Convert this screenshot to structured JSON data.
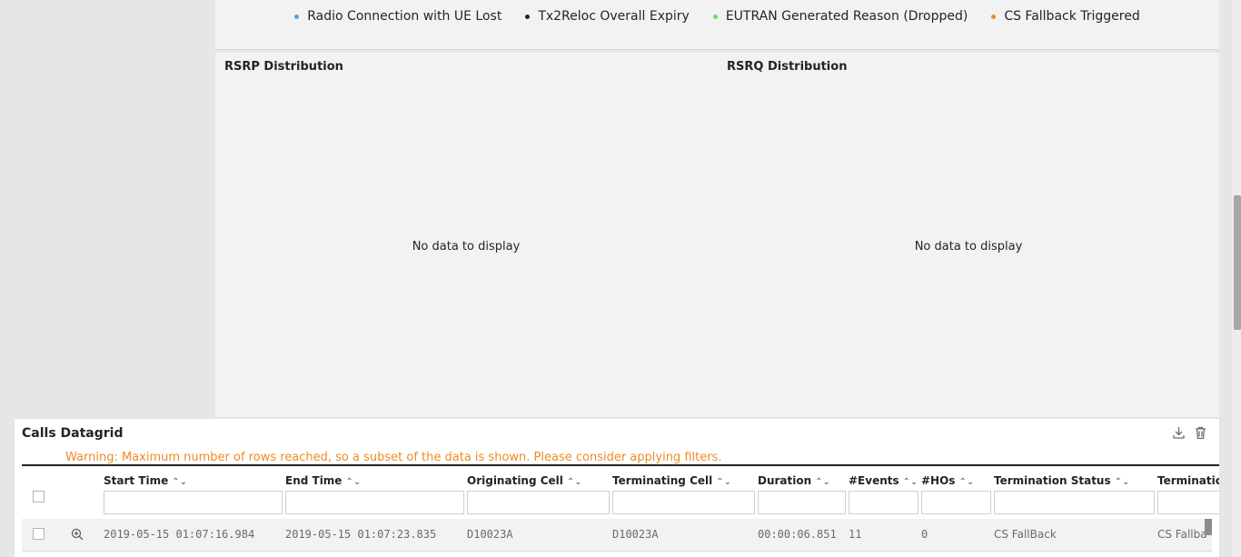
{
  "legend": [
    {
      "label": "Radio Connection with UE Lost",
      "color": "#4da6e6"
    },
    {
      "label": "Tx2Reloc Overall Expiry",
      "color": "#242424"
    },
    {
      "label": "EUTRAN Generated Reason (Dropped)",
      "color": "#5ee068"
    },
    {
      "label": "CS Fallback Triggered",
      "color": "#f08a24"
    }
  ],
  "charts": {
    "rsrp": {
      "title": "RSRP Distribution",
      "empty": "No data to display"
    },
    "rsrq": {
      "title": "RSRQ Distribution",
      "empty": "No data to display"
    }
  },
  "grid": {
    "title": "Calls Datagrid",
    "warning": "Warning: Maximum number of rows reached, so a subset of the data is shown. Please consider applying filters.",
    "columns": [
      "Start Time",
      "End Time",
      "Originating Cell",
      "Terminating Cell",
      "Duration",
      "#Events",
      "#HOs",
      "Termination Status",
      "Terminatic"
    ],
    "rows": [
      [
        "2019-05-15 01:07:16.984",
        "2019-05-15 01:07:23.835",
        "D10023A",
        "D10023A",
        "00:00:06.851",
        "11",
        "0",
        "CS FallBack",
        "CS Fallba"
      ]
    ],
    "icons": {
      "download": "download-icon",
      "delete": "trash-icon",
      "zoom": "zoom-in-icon"
    }
  }
}
